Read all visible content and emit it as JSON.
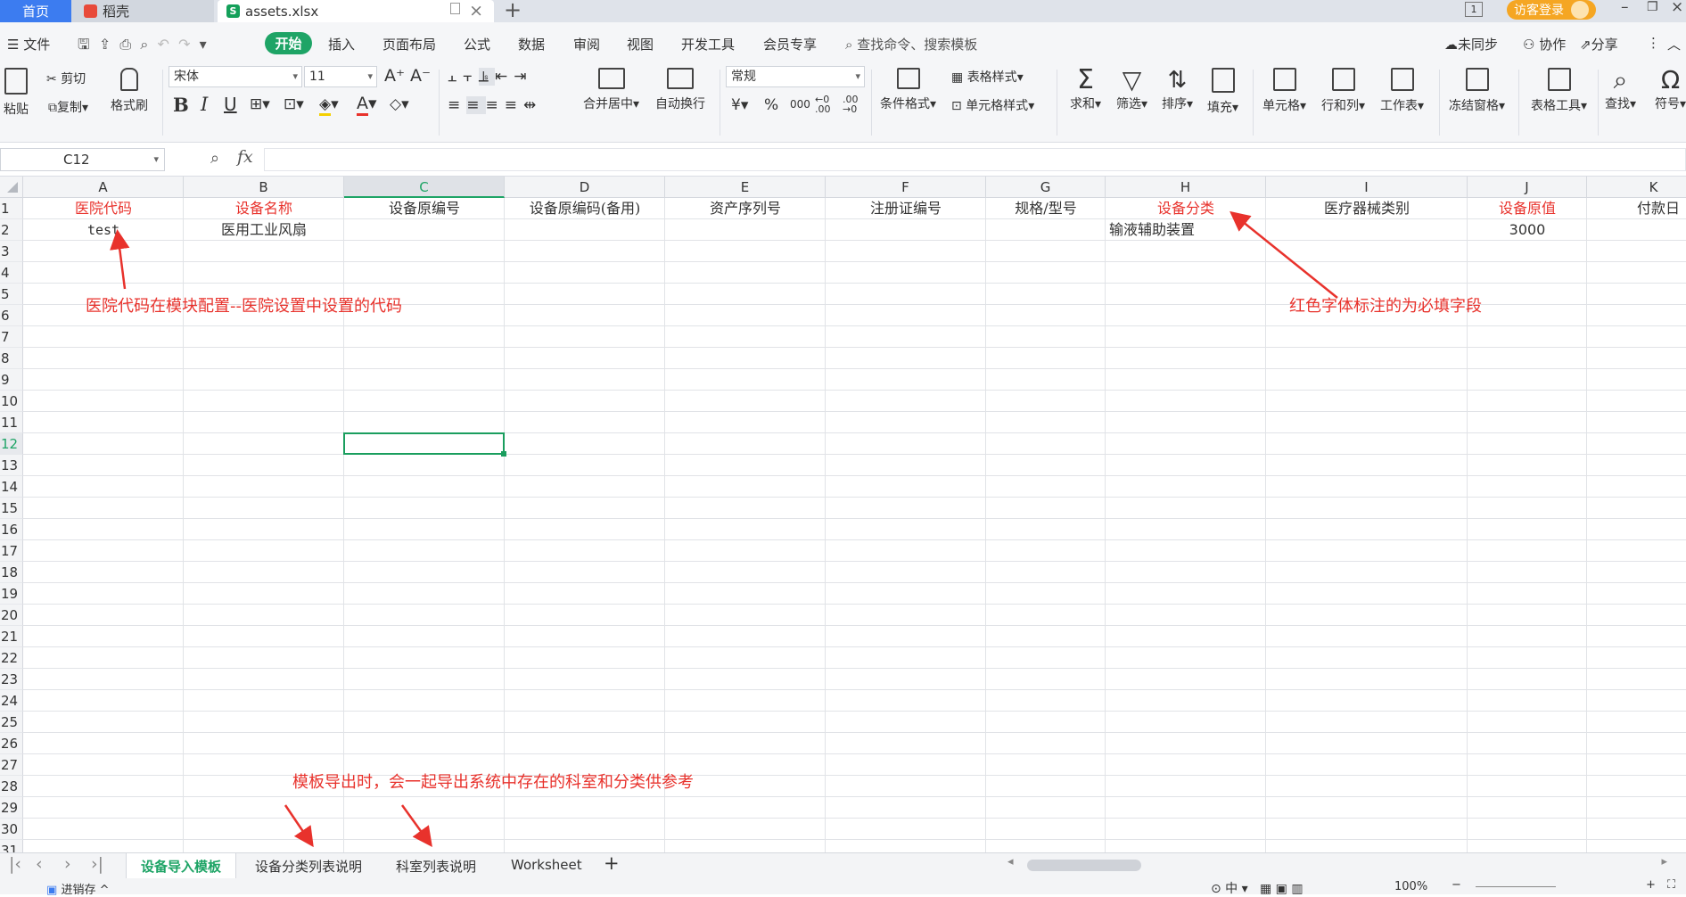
{
  "titlebar": {
    "tab_home": "首页",
    "tab_docer": "稻壳",
    "tab_file": "assets.xlsx",
    "win_counter": "1",
    "login": "访客登录"
  },
  "menubar": {
    "file": "文件",
    "items": [
      "开始",
      "插入",
      "页面布局",
      "公式",
      "数据",
      "审阅",
      "视图",
      "开发工具",
      "会员专享"
    ],
    "search": "查找命令、搜索模板",
    "sync": "未同步",
    "collab": "协作",
    "share": "分享"
  },
  "ribbon": {
    "paste": "粘贴",
    "cut": "剪切",
    "copy": "复制",
    "format_painter": "格式刷",
    "font_name": "宋体",
    "font_size": "11",
    "bold": "B",
    "italic": "I",
    "underline": "U",
    "merge_center": "合并居中",
    "wrap_text": "自动换行",
    "number_format": "常规",
    "currency": "¥",
    "percent": "%",
    "thousands": "000",
    "dec_inc": "←0 .00",
    "dec_dec": ".00 →0",
    "conditional": "条件格式",
    "table_style": "表格样式",
    "cell_style": "单元格样式",
    "sum": "求和",
    "filter": "筛选",
    "sort": "排序",
    "fill": "填充",
    "cells": "单元格",
    "rowcol": "行和列",
    "sheet": "工作表",
    "freeze": "冻结窗格",
    "table_tools": "表格工具",
    "find": "查找",
    "symbol": "符号"
  },
  "formula": {
    "namebox": "C12",
    "fx": "fx",
    "value": ""
  },
  "columns": [
    "A",
    "B",
    "C",
    "D",
    "E",
    "F",
    "G",
    "H",
    "I",
    "J",
    "K"
  ],
  "selected": {
    "column": "C",
    "row": "12"
  },
  "headers": {
    "A": "医院代码",
    "B": "设备名称",
    "C": "设备原编号",
    "D": "设备原编码(备用)",
    "E": "资产序列号",
    "F": "注册证编号",
    "G": "规格/型号",
    "H": "设备分类",
    "I": "医疗器械类别",
    "J": "设备原值",
    "K": "付款日"
  },
  "required_columns": [
    "A",
    "B",
    "H",
    "J"
  ],
  "row2": {
    "A": "test",
    "B": "医用工业风扇",
    "H": "输液辅助装置",
    "J": "3000"
  },
  "annotations": {
    "hospital_code": "医院代码在模块配置--医院设置中设置的代码",
    "required": "红色字体标注的为必填字段",
    "export": "模板导出时，会一起导出系统中存在的科室和分类供参考"
  },
  "sheets": [
    "设备导入模板",
    "设备分类列表说明",
    "科室列表说明",
    "Worksheet"
  ],
  "active_sheet": "设备导入模板",
  "statusbar": {
    "module": "进销存",
    "zoom": "100%"
  },
  "colors": {
    "accent": "#1ea466",
    "required": "#e8322c",
    "home_tab": "#3c7cf0"
  }
}
